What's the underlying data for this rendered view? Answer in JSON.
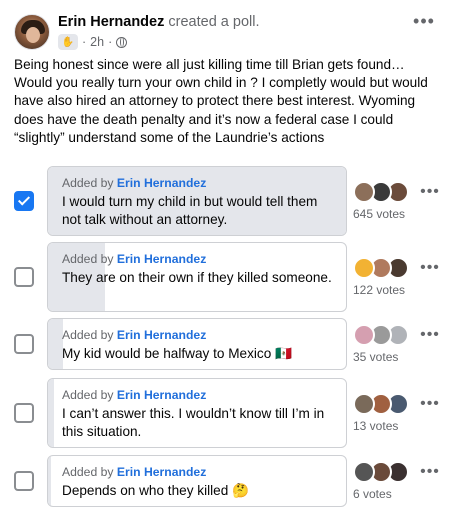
{
  "post": {
    "author": "Erin Hernandez",
    "action": "created a poll.",
    "time": "2h",
    "body": "Being honest since were all just killing time till Brian gets found… Would you really turn your own child in ? I completly would but would have also hired an attorney to protect there best interest. Wyoming does have the death penalty and it’s now a federal case I could “slightly” understand some of the Laundrie’s actions"
  },
  "poll": {
    "added_prefix": "Added by",
    "options": [
      {
        "added_by": "Erin Hernandez",
        "text": "I would turn my child in but would tell them not talk without an attorney.",
        "votes": "645 votes",
        "selected": true,
        "share": 1.0,
        "avatars": [
          "#8c6f5a",
          "#3a3a3a",
          "#6b4b3a"
        ]
      },
      {
        "added_by": "Erin Hernandez",
        "text": "They are on their own if they killed someone.",
        "votes": "122 votes",
        "selected": false,
        "share": 0.19,
        "avatars": [
          "#f2b233",
          "#b07a5e",
          "#4a3a30"
        ]
      },
      {
        "added_by": "Erin Hernandez",
        "text": "My kid would be halfway to Mexico 🇲🇽",
        "votes": "35 votes",
        "selected": false,
        "share": 0.05,
        "avatars": [
          "#d59fb0",
          "#9a9a9a",
          "#b0b3b8"
        ]
      },
      {
        "added_by": "Erin Hernandez",
        "text": "I can’t answer this. I wouldn’t know till I’m in this situation.",
        "votes": "13 votes",
        "selected": false,
        "share": 0.02,
        "avatars": [
          "#7a6a5a",
          "#a06040",
          "#4a5a70"
        ]
      },
      {
        "added_by": "Erin Hernandez",
        "text": "Depends on who they killed 🤔",
        "votes": "6 votes",
        "selected": false,
        "share": 0.01,
        "avatars": [
          "#555555",
          "#6a4a3a",
          "#3a3030"
        ]
      }
    ]
  }
}
